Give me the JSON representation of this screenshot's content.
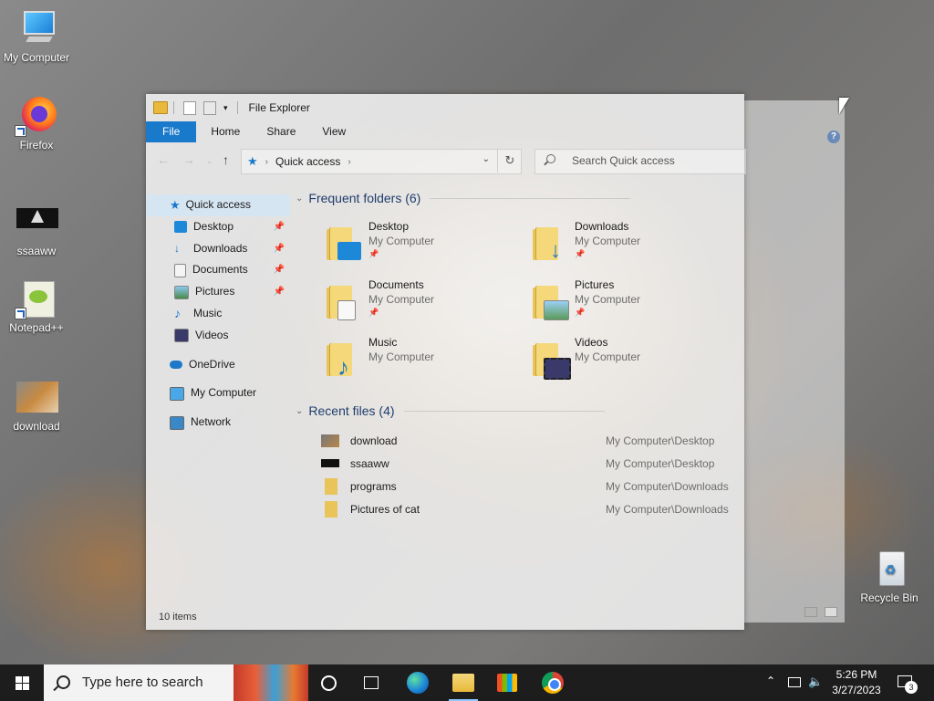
{
  "desktop": {
    "icons": [
      {
        "label": "My Computer"
      },
      {
        "label": "Firefox"
      },
      {
        "label": "ssaaww"
      },
      {
        "label": "Notepad++"
      },
      {
        "label": "download"
      },
      {
        "label": "Recycle Bin"
      }
    ]
  },
  "window": {
    "title": "File Explorer",
    "ribbon_tabs": [
      "File",
      "Home",
      "Share",
      "View"
    ],
    "address": {
      "location": "Quick access"
    },
    "search": {
      "placeholder": "Search Quick access"
    },
    "nav": {
      "quick_access": "Quick access",
      "pinned": [
        "Desktop",
        "Downloads",
        "Documents",
        "Pictures"
      ],
      "unpinned": [
        "Music",
        "Videos"
      ],
      "onedrive": "OneDrive",
      "my_computer": "My Computer",
      "network": "Network"
    },
    "frequent": {
      "header": "Frequent folders (6)",
      "items": [
        {
          "name": "Desktop",
          "location": "My Computer"
        },
        {
          "name": "Downloads",
          "location": "My Computer"
        },
        {
          "name": "Documents",
          "location": "My Computer"
        },
        {
          "name": "Pictures",
          "location": "My Computer"
        },
        {
          "name": "Music",
          "location": "My Computer"
        },
        {
          "name": "Videos",
          "location": "My Computer"
        }
      ]
    },
    "recent": {
      "header": "Recent files (4)",
      "items": [
        {
          "name": "download",
          "path": "My Computer\\Desktop"
        },
        {
          "name": "ssaaww",
          "path": "My Computer\\Desktop"
        },
        {
          "name": "programs",
          "path": "My Computer\\Downloads"
        },
        {
          "name": "Pictures of cat",
          "path": "My Computer\\Downloads"
        }
      ]
    },
    "status": "10 items"
  },
  "taskbar": {
    "search_placeholder": "Type here to search",
    "time": "5:26 PM",
    "date": "3/27/2023",
    "notifications": "3"
  },
  "colors": {
    "accent": "#1979ca",
    "taskbar": "#1d1d1d"
  }
}
